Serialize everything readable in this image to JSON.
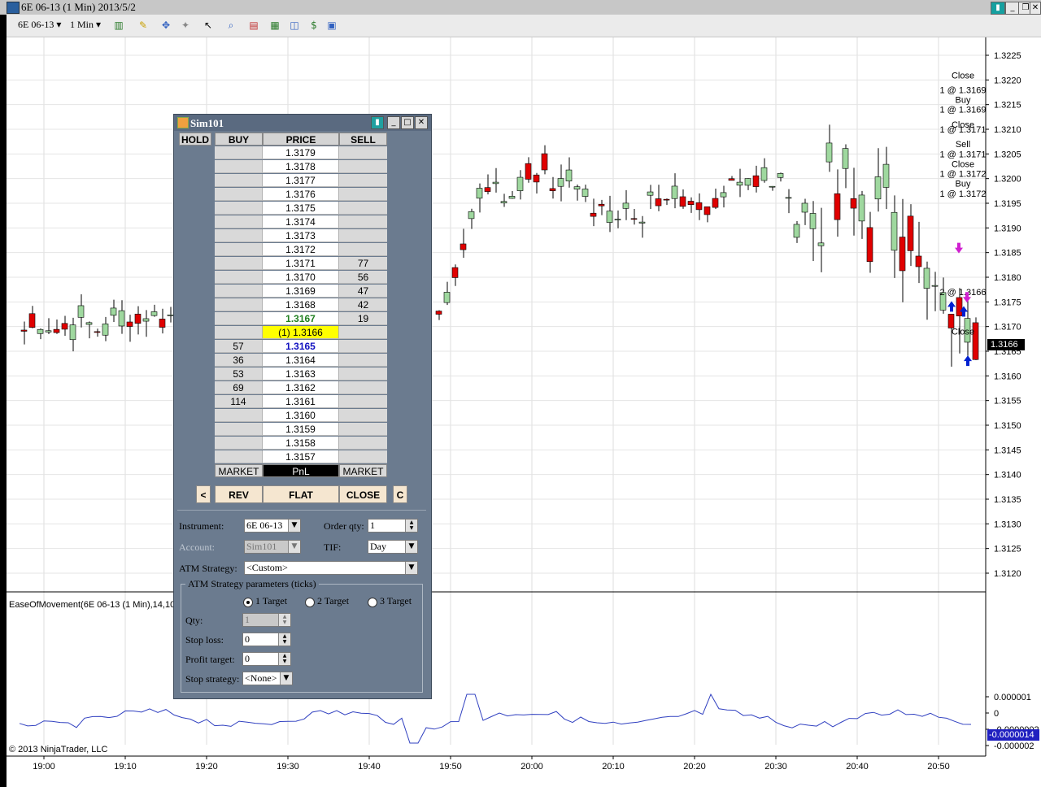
{
  "window": {
    "title": "6E 06-13 (1 Min)  2013/5/2"
  },
  "toolbar": {
    "instrument": "6E 06-13",
    "interval": "1 Min"
  },
  "chart": {
    "indicator_label": "EaseOfMovement(6E 06-13 (1 Min),14,10",
    "copyright": "© 2013 NinjaTrader, LLC",
    "last_price_label": "1.3166",
    "indicator_last_label": "-0.0000014",
    "price_ticks": [
      "1.3225",
      "1.3220",
      "1.3215",
      "1.3210",
      "1.3205",
      "1.3200",
      "1.3195",
      "1.3190",
      "1.3185",
      "1.3180",
      "1.3175",
      "1.3170",
      "1.3165",
      "1.3160",
      "1.3155",
      "1.3150",
      "1.3145",
      "1.3140",
      "1.3135",
      "1.3130",
      "1.3125",
      "1.3120"
    ],
    "indicator_ticks": [
      "0.000001",
      "0",
      "-0.0000002",
      "-0.000002"
    ],
    "time_ticks": [
      "19:00",
      "19:10",
      "19:20",
      "19:30",
      "19:40",
      "19:50",
      "20:00",
      "20:10",
      "20:20",
      "20:30",
      "20:40",
      "20:50"
    ],
    "annotations": [
      {
        "text": "Close",
        "y": 1.3221
      },
      {
        "text": "1 @ 1.3169",
        "y": 1.3218
      },
      {
        "text": "Buy",
        "y": 1.3216
      },
      {
        "text": "1 @ 1.3169",
        "y": 1.3214
      },
      {
        "text": "Close",
        "y": 1.3211
      },
      {
        "text": "1 @ 1.3171",
        "y": 1.321
      },
      {
        "text": "Sell",
        "y": 1.3207
      },
      {
        "text": "1 @ 1.3171",
        "y": 1.3205
      },
      {
        "text": "Close",
        "y": 1.3203
      },
      {
        "text": "1 @ 1.3172",
        "y": 1.3201
      },
      {
        "text": "Buy",
        "y": 1.3199
      },
      {
        "text": "1 @ 1.3172",
        "y": 1.3197
      },
      {
        "text": "Close",
        "y": 1.3169
      },
      {
        "text": "2 @ 1.3166",
        "y": 1.3177
      }
    ]
  },
  "sim": {
    "title": "Sim101",
    "hold_label": "HOLD",
    "headers": {
      "buy": "BUY",
      "price": "PRICE",
      "sell": "SELL"
    },
    "rows": [
      {
        "buy": "",
        "price": "1.3179",
        "sell": ""
      },
      {
        "buy": "",
        "price": "1.3178",
        "sell": ""
      },
      {
        "buy": "",
        "price": "1.3177",
        "sell": ""
      },
      {
        "buy": "",
        "price": "1.3176",
        "sell": ""
      },
      {
        "buy": "",
        "price": "1.3175",
        "sell": ""
      },
      {
        "buy": "",
        "price": "1.3174",
        "sell": ""
      },
      {
        "buy": "",
        "price": "1.3173",
        "sell": ""
      },
      {
        "buy": "",
        "price": "1.3172",
        "sell": ""
      },
      {
        "buy": "",
        "price": "1.3171",
        "sell": "77"
      },
      {
        "buy": "",
        "price": "1.3170",
        "sell": "56"
      },
      {
        "buy": "",
        "price": "1.3169",
        "sell": "47"
      },
      {
        "buy": "",
        "price": "1.3168",
        "sell": "42"
      },
      {
        "buy": "",
        "price": "1.3167",
        "sell": "19",
        "style": "ask"
      },
      {
        "buy": "",
        "price": "(1) 1.3166",
        "sell": "",
        "style": "last"
      },
      {
        "buy": "57",
        "price": "1.3165",
        "sell": "",
        "style": "bid"
      },
      {
        "buy": "36",
        "price": "1.3164",
        "sell": ""
      },
      {
        "buy": "53",
        "price": "1.3163",
        "sell": ""
      },
      {
        "buy": "69",
        "price": "1.3162",
        "sell": ""
      },
      {
        "buy": "114",
        "price": "1.3161",
        "sell": ""
      },
      {
        "buy": "",
        "price": "1.3160",
        "sell": ""
      },
      {
        "buy": "",
        "price": "1.3159",
        "sell": ""
      },
      {
        "buy": "",
        "price": "1.3158",
        "sell": ""
      },
      {
        "buy": "",
        "price": "1.3157",
        "sell": ""
      }
    ],
    "footer": {
      "left": "MARKET",
      "mid": "PnL",
      "right": "MARKET"
    },
    "buttons": {
      "left_arrow": "<",
      "rev": "REV",
      "flat": "FLAT",
      "close": "CLOSE",
      "c": "C"
    },
    "form": {
      "instrument_label": "Instrument:",
      "instrument_value": "6E 06-13",
      "order_qty_label": "Order qty:",
      "order_qty_value": "1",
      "account_label": "Account:",
      "account_value": "Sim101",
      "tif_label": "TIF:",
      "tif_value": "Day",
      "atm_label": "ATM Strategy:",
      "atm_value": "<Custom>",
      "params_legend": "ATM Strategy parameters (ticks)",
      "target1": "1 Target",
      "target2": "2 Target",
      "target3": "3 Target",
      "qty_label": "Qty:",
      "qty_value": "1",
      "stop_loss_label": "Stop loss:",
      "stop_loss_value": "0",
      "profit_target_label": "Profit target:",
      "profit_target_value": "0",
      "stop_strategy_label": "Stop strategy:",
      "stop_strategy_value": "<None>"
    }
  },
  "colors": {
    "up_candle": "#9fd89f",
    "down_candle": "#e00000",
    "indicator_line": "#3040c0",
    "bid": "#1010c0",
    "ask": "#208020",
    "last": "#ffff00"
  }
}
